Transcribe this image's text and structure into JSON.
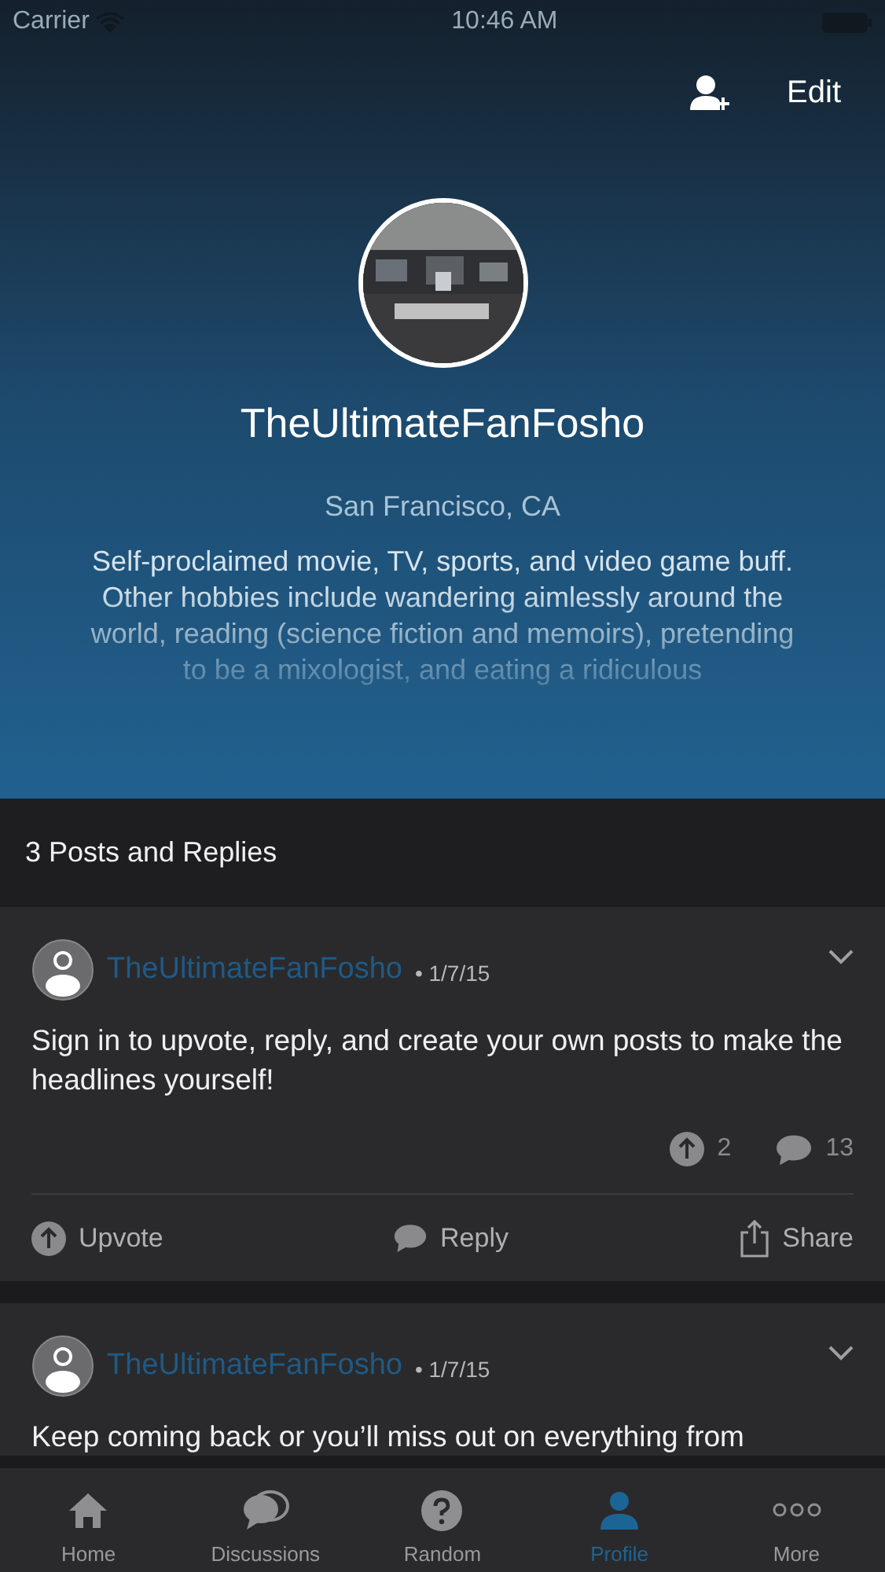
{
  "status_bar": {
    "carrier": "Carrier",
    "time": "10:46 AM"
  },
  "header": {
    "edit": "Edit"
  },
  "profile": {
    "username": "TheUltimateFanFosho",
    "location": "San Francisco, CA",
    "bio": "Self-proclaimed movie, TV, sports, and video game buff. Other hobbies include wandering aimlessly around the world, reading (science fiction and memoirs), pretending to be a mixologist, and eating a ridiculous"
  },
  "section_title": "3 Posts and Replies",
  "posts": [
    {
      "author": "TheUltimateFanFosho",
      "date": "• 1/7/15",
      "text": "Sign in to upvote, reply, and create your own posts to make the headlines yourself!",
      "upvotes": "2",
      "comments": "13",
      "actions": {
        "upvote": "Upvote",
        "reply": "Reply",
        "share": "Share"
      }
    },
    {
      "author": "TheUltimateFanFosho",
      "date": "• 1/7/15",
      "text": "Keep coming back or you’ll miss out on everything from"
    }
  ],
  "tab_bar": [
    {
      "kind": "home",
      "label": "Home",
      "selected": false
    },
    {
      "kind": "discussions",
      "label": "Discussions",
      "selected": false
    },
    {
      "kind": "random",
      "label": "Random",
      "selected": false
    },
    {
      "kind": "profile",
      "label": "Profile",
      "selected": true
    },
    {
      "kind": "more",
      "label": "More",
      "selected": false
    }
  ]
}
